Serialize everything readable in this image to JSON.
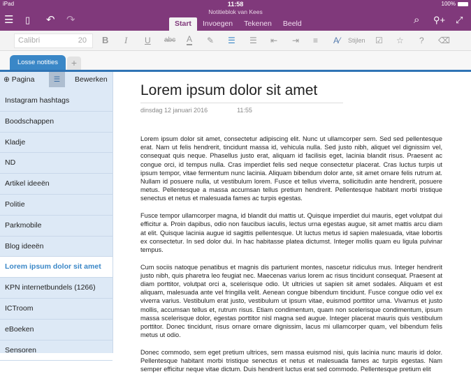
{
  "status": {
    "device": "iPad",
    "time": "11:58",
    "battery": "100%"
  },
  "app": {
    "title": "Notitieblok van Kees"
  },
  "ribbon_tabs": [
    "Start",
    "Invoegen",
    "Tekenen",
    "Beeld"
  ],
  "toolbar": {
    "font": "Calibri",
    "size": "20",
    "bold": "B",
    "italic": "I",
    "underline": "U",
    "strike": "abc",
    "fontcolor": "A",
    "styles": "Stijlen",
    "help": "?"
  },
  "section": {
    "name": "Losse notities",
    "add": "+"
  },
  "sidebar": {
    "add_page": "Pagina",
    "edit": "Bewerken",
    "pages": [
      "Instagram hashtags",
      "Boodschappen",
      "Kladje",
      "ND",
      "Artikel ideeën",
      "Politie",
      "Parkmobile",
      "Blog ideeën",
      "Lorem ipsum dolor sit amet",
      "KPN internetbundels (1266)",
      "ICTroom",
      "eBoeken",
      "Sensoren"
    ],
    "selected": 8
  },
  "page": {
    "title": "Lorem ipsum dolor sit amet",
    "date": "dinsdag 12 januari 2016",
    "time": "11:55",
    "paragraphs": [
      "Lorem ipsum dolor sit amet, consectetur adipiscing elit. Nunc ut ullamcorper sem. Sed sed pellentesque erat. Nam ut felis hendrerit, tincidunt massa id, vehicula nulla. Sed justo nibh, aliquet vel dignissim vel, consequat quis neque. Phasellus justo erat, aliquam id facilisis eget, lacinia blandit risus. Praesent ac congue orci, id tempus nulla. Cras imperdiet felis sed neque consectetur placerat. Cras luctus turpis ut ipsum tempor, vitae fermentum nunc lacinia. Aliquam bibendum dolor ante, sit amet ornare felis rutrum at. Nullam id posuere nulla, ut vestibulum lorem. Fusce et tellus viverra, sollicitudin ante hendrerit, posuere metus. Pellentesque a massa accumsan tellus pretium hendrerit. Pellentesque habitant morbi tristique senectus et netus et malesuada fames ac turpis egestas.",
      "Fusce tempor ullamcorper magna, id blandit dui mattis ut. Quisque imperdiet dui mauris, eget volutpat dui efficitur a. Proin dapibus, odio non faucibus iaculis, lectus urna egestas augue, sit amet mattis arcu diam at elit. Quisque lacinia augue id sagittis pellentesque. Ut luctus metus id sapien malesuada, vitae lobortis ex consectetur. In sed dolor dui. In hac habitasse platea dictumst. Integer mollis quam eu ligula pulvinar tempus.",
      "Cum sociis natoque penatibus et magnis dis parturient montes, nascetur ridiculus mus. Integer hendrerit justo nibh, quis pharetra leo feugiat nec. Maecenas varius lorem ac risus tincidunt consequat. Praesent at diam porttitor, volutpat orci a, scelerisque odio. Ut ultricies ut sapien sit amet sodales. Aliquam et est aliquam, malesuada ante vel fringilla velit. Aenean congue bibendum tincidunt. Fusce congue odio vel ex viverra varius. Vestibulum erat justo, vestibulum ut ipsum vitae, euismod porttitor urna. Vivamus et justo mollis, accumsan tellus et, rutrum risus. Etiam condimentum, quam non scelerisque condimentum, ipsum massa scelerisque dolor, egestas porttitor nisl magna sed augue. Integer placerat mauris quis vestibulum porttitor. Donec tincidunt, risus ornare ornare dignissim, lacus mi ullamcorper quam, vel bibendum felis metus ut odio.",
      "Donec commodo, sem eget pretium ultrices, sem massa euismod nisi, quis lacinia nunc mauris id dolor. Pellentesque habitant morbi tristique senectus et netus et malesuada fames ac turpis egestas. Nam semper efficitur neque vitae dictum. Duis hendrerit luctus erat sed commodo. Pellentesque pretium elit"
    ]
  },
  "colors": {
    "brand": "#80397b",
    "section": "#3a87c7",
    "sidebar": "#dde9f6"
  }
}
